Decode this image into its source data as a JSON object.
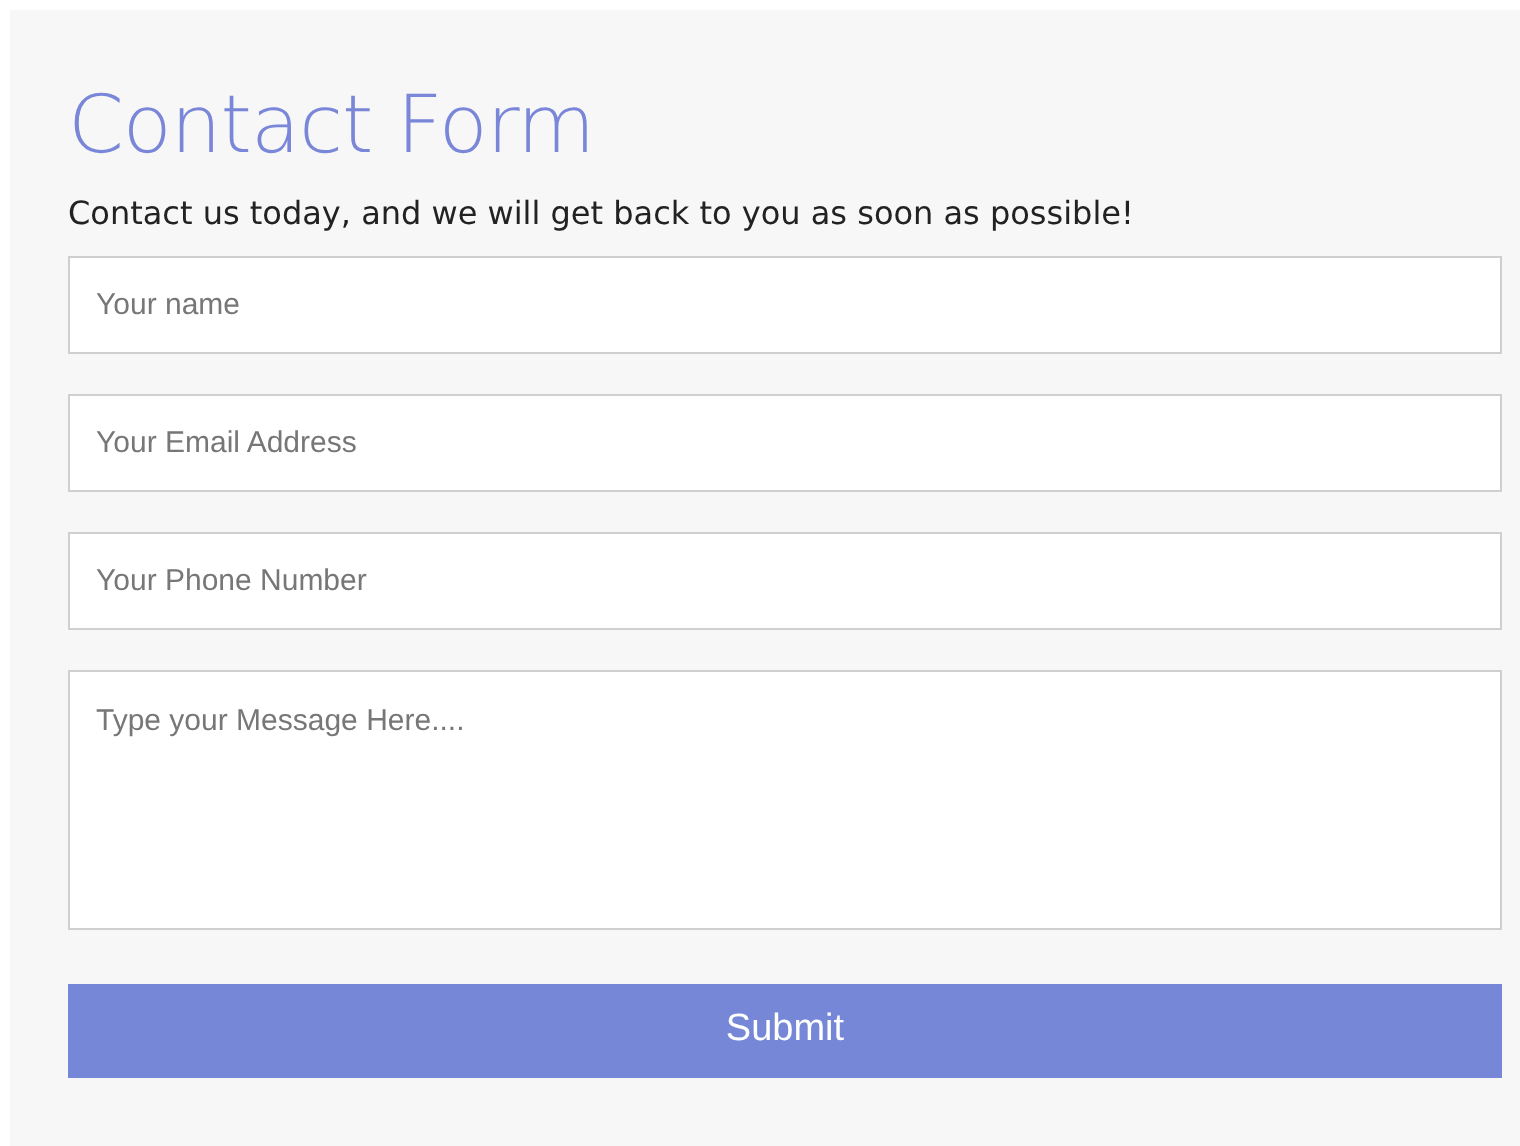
{
  "title": "Contact Form",
  "subtitle": "Contact us today, and we will get back to you as soon as possible!",
  "fields": [
    {
      "kind": "input",
      "placeholder": "Your name"
    },
    {
      "kind": "input",
      "placeholder": "Your Email Address"
    },
    {
      "kind": "input",
      "placeholder": "Your Phone Number"
    },
    {
      "kind": "textarea",
      "placeholder": "Type your Message Here...."
    }
  ],
  "submit": "Submit"
}
